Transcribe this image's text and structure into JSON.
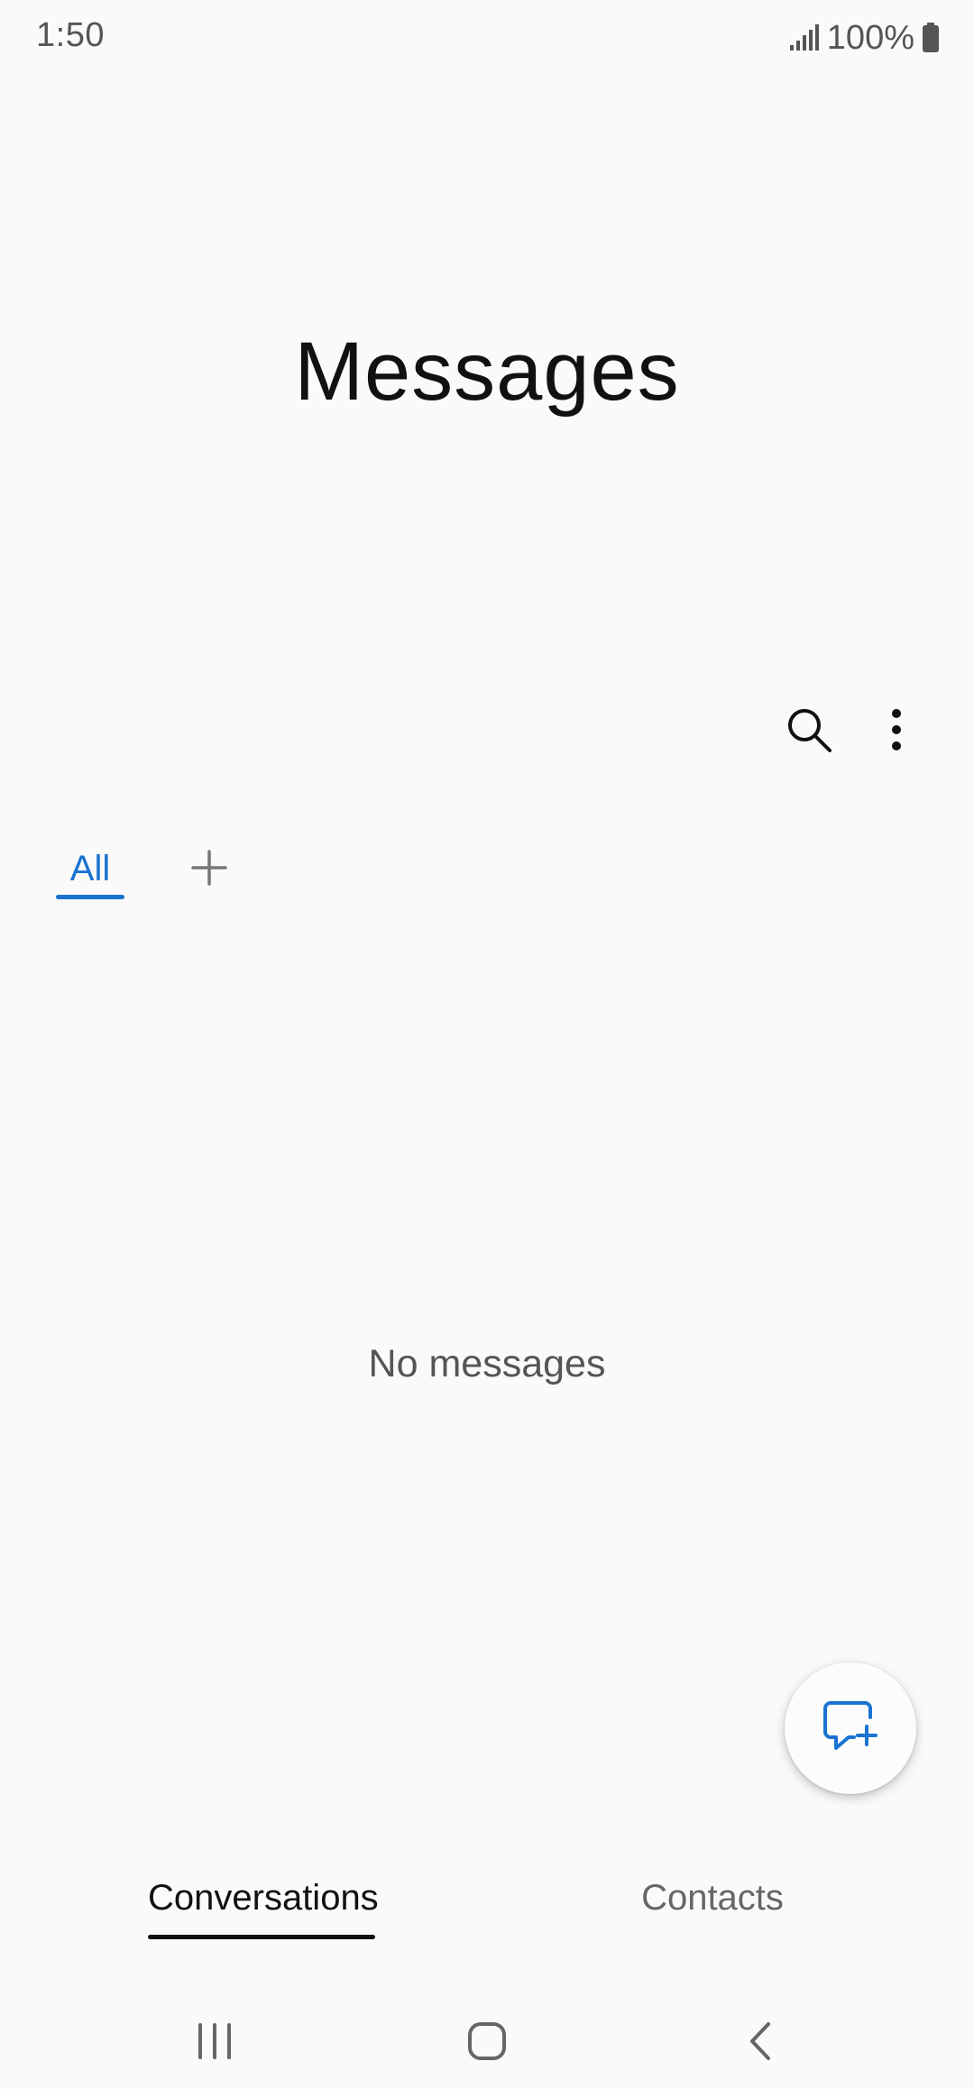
{
  "status_bar": {
    "time": "1:50",
    "battery": "100%",
    "icons": [
      "signal-icon",
      "battery-icon"
    ]
  },
  "header": {
    "title": "Messages"
  },
  "toolbar": {
    "icons": [
      "search-icon",
      "more-options-icon"
    ]
  },
  "categories": {
    "tabs": [
      {
        "label": "All",
        "selected": true
      }
    ],
    "add_icon": "plus-icon"
  },
  "main": {
    "empty_message": "No messages"
  },
  "fab": {
    "icon": "new-message-icon"
  },
  "bottom_tabs": [
    {
      "label": "Conversations",
      "selected": true
    },
    {
      "label": "Contacts",
      "selected": false
    }
  ],
  "nav_bar": {
    "icons": [
      "recents-icon",
      "home-icon",
      "back-icon"
    ]
  },
  "colors": {
    "accent": "#1a73d1",
    "background": "#fafafa",
    "text_primary": "#111111",
    "text_secondary": "#555555"
  }
}
